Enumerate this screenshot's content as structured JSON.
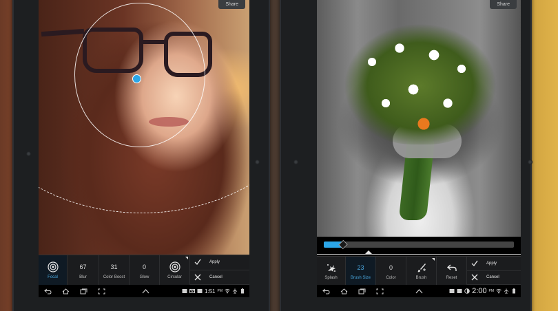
{
  "left": {
    "share_label": "Share",
    "tools": [
      {
        "id": "focal",
        "value": "",
        "label": "Focal",
        "icon": "focal-target-icon",
        "selected": true
      },
      {
        "id": "blur",
        "value": "67",
        "label": "Blur",
        "selected": false
      },
      {
        "id": "color-boost",
        "value": "31",
        "label": "Color Boost",
        "selected": false
      },
      {
        "id": "glow",
        "value": "0",
        "label": "Glow",
        "selected": false
      },
      {
        "id": "circular",
        "value": "",
        "label": "Circular",
        "icon": "circular-target-icon",
        "selected": false
      }
    ],
    "actions": {
      "apply": "Apply",
      "cancel": "Cancel"
    },
    "status": {
      "time": "1:51",
      "ampm": "PM"
    }
  },
  "right": {
    "share_label": "Share",
    "brush_size_level": 0.1,
    "tools": [
      {
        "id": "splash",
        "value": "",
        "label": "Splash",
        "icon": "splash-icon",
        "selected": false
      },
      {
        "id": "brush-size",
        "value": "23",
        "label": "Brush Size",
        "selected": true
      },
      {
        "id": "color",
        "value": "0",
        "label": "Color",
        "selected": false
      },
      {
        "id": "brush",
        "value": "",
        "label": "Brush",
        "icon": "brush-icon",
        "selected": false
      },
      {
        "id": "reset",
        "value": "",
        "label": "Reset",
        "icon": "reset-arrow-icon",
        "selected": false
      }
    ],
    "actions": {
      "apply": "Apply",
      "cancel": "Cancel"
    },
    "status": {
      "time": "2:00",
      "ampm": "PM"
    }
  },
  "colors": {
    "accent": "#2ba6e8",
    "toolbar_bg": "#1b1c1e"
  }
}
